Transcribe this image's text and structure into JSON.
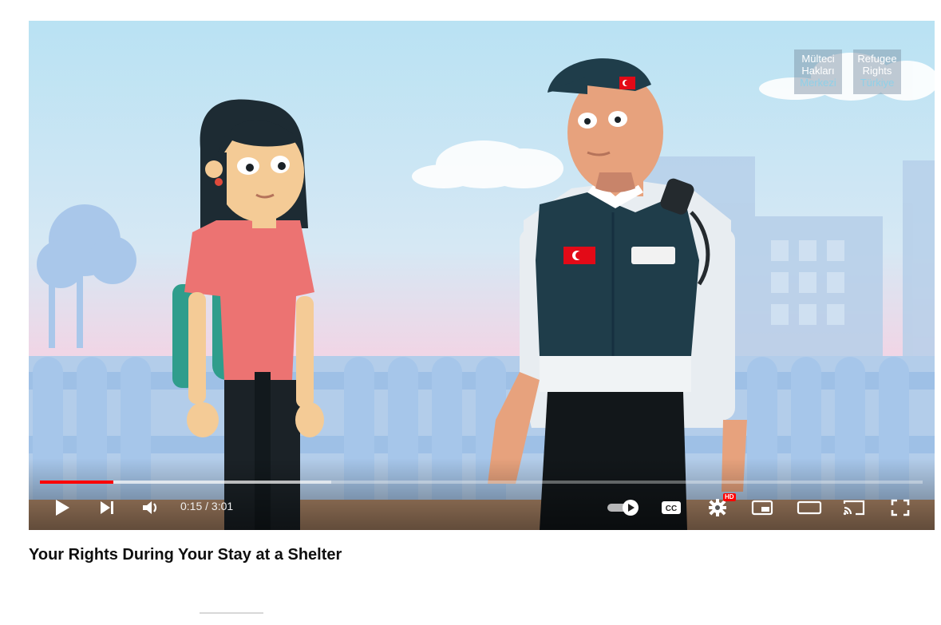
{
  "video": {
    "title": "Your Rights During Your Stay at a Shelter",
    "time_display": "0:15 / 3:01",
    "progress_played": 0.083,
    "progress_buffered": 0.33
  },
  "watermark": {
    "left": [
      "Mülteci",
      "Hakları",
      "Merkezi"
    ],
    "right": [
      "Refugee",
      "Rights",
      "Türkiye"
    ]
  },
  "controls": {
    "hd_label": "HD",
    "icons": [
      "play-icon",
      "next-icon",
      "volume-icon",
      "autoplay-toggle-icon",
      "captions-icon",
      "settings-icon",
      "miniplayer-icon",
      "theater-icon",
      "cast-icon",
      "fullscreen-icon"
    ]
  },
  "colors": {
    "progress_played": "#ff0000",
    "sky": "#bfe3f2",
    "uniform": "#1f3d4a",
    "flag": "#e30a17"
  }
}
